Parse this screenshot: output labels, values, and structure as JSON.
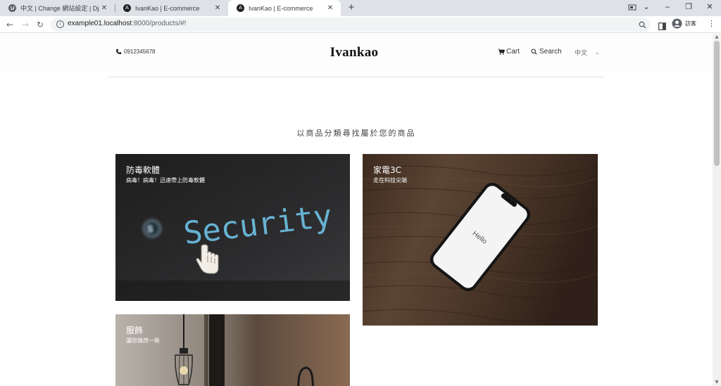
{
  "browser": {
    "tabs": [
      {
        "title": "中文 | Change 網站設定 | Django"
      },
      {
        "title": "IvanKao | E-commerce"
      },
      {
        "title": "IvanKao | E-commerce"
      }
    ],
    "close_glyph": "✕",
    "new_tab_glyph": "+",
    "url_host": "example01.localhost",
    "url_path": ":8000/products/#!",
    "profile_label": "訪客",
    "colors": {
      "tabbar": "#dee1e6",
      "omnibox": "#f1f3f4"
    }
  },
  "header": {
    "phone": "0912345678",
    "logo": "Ivankao",
    "cart_label": "Cart",
    "search_label": "Search",
    "language": "中文"
  },
  "main": {
    "section_title": "以商品分類尋找屬於您的商品",
    "categories": [
      {
        "title": "防毒軟體",
        "subtitle": "病毒！病毒！迅速帶上防毒軟體",
        "image_text": "Security",
        "image_icon": "hand-cursor-icon"
      },
      {
        "title": "家電3C",
        "subtitle": "走在科技尖端",
        "image_text": "Hello",
        "image_icon": "smartphone-icon"
      },
      {
        "title": "服飾",
        "subtitle": "讓您煥然一新",
        "image_icon": "lamp-icon"
      }
    ]
  }
}
